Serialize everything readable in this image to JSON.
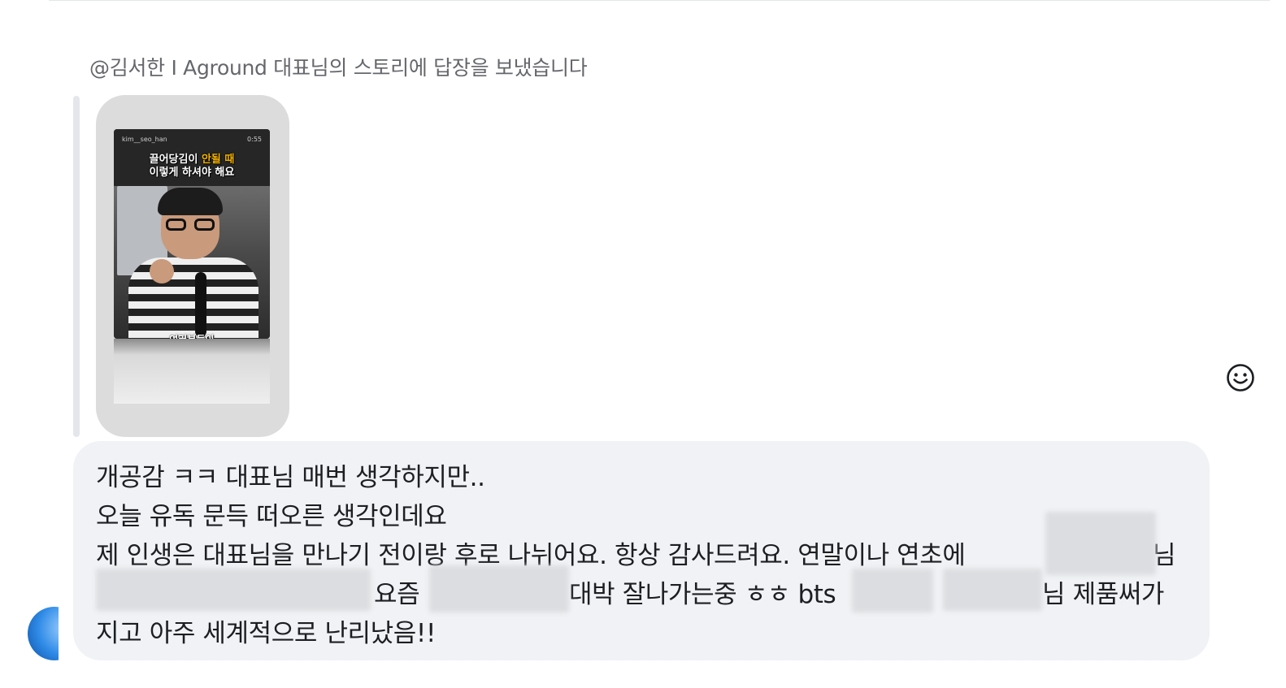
{
  "reply_caption": "@김서한 I Aground 대표님의 스토리에 답장을 보냈습니다",
  "story": {
    "username": "kim__seo_han",
    "duration": "0:55",
    "headline_part1": "끌어당김이 ",
    "headline_highlight": "안될 때",
    "headline_line2": "이렇게 하셔야 해요",
    "subtitle": "여러분들이"
  },
  "message": {
    "line1": "개공감 ㅋㅋ 대표님 매번 생각하지만..",
    "line2": "오늘 유독 문득 떠오른 생각인데요",
    "line3_a": "제 인생은 대표님을 만나기 전이랑 후로 나뉘어요. 항상 감사드려요. 연말이나 연초에",
    "line3_b": "님",
    "line4_a": "요즘",
    "line4_b": "대박 잘나가는중 ㅎㅎ bts",
    "line4_c": "님 제품써가",
    "line5": "지고 아주 세계적으로 난리났음!!"
  },
  "icons": {
    "emoji": "smiley-face-icon",
    "avatar": "user-avatar"
  },
  "colors": {
    "bubble": "#f0f2f5",
    "caption": "#65676b",
    "text": "#1c1e21",
    "highlight": "#f5b400"
  }
}
